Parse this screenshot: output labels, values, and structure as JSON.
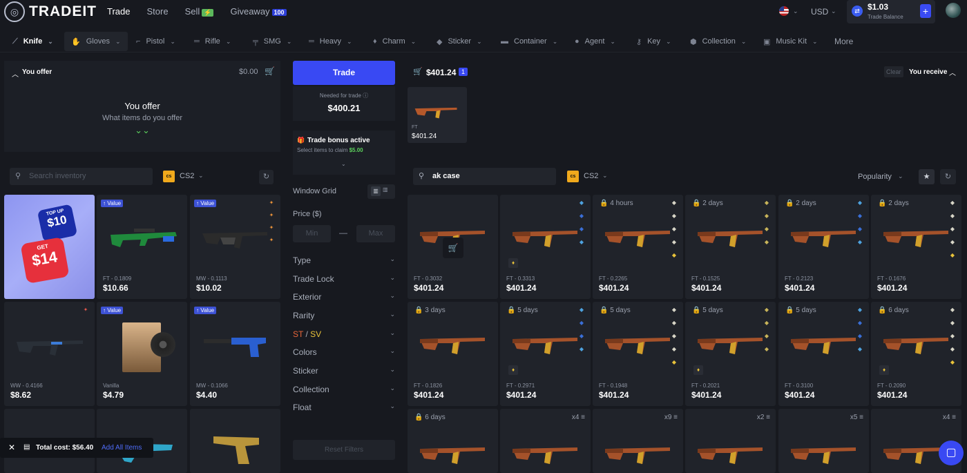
{
  "brand": "TRADEIT",
  "topnav": {
    "trade": "Trade",
    "store": "Store",
    "sell": "Sell",
    "sell_badge": "⚡",
    "giveaway": "Giveaway",
    "giveaway_badge": "100"
  },
  "currency": "USD",
  "balance": {
    "amount": "$1.03",
    "label": "Trade Balance"
  },
  "categories": [
    "Knife",
    "Gloves",
    "Pistol",
    "Rifle",
    "SMG",
    "Heavy",
    "Charm",
    "Sticker",
    "Container",
    "Agent",
    "Key",
    "Collection",
    "Music Kit",
    "More"
  ],
  "offer": {
    "header": "You offer",
    "total": "$0.00",
    "title": "You offer",
    "subtitle": "What items do you offer"
  },
  "search_inv": {
    "placeholder": "Search inventory",
    "game": "CS2"
  },
  "trade": {
    "button": "Trade",
    "needed_label": "Needed for trade",
    "needed_value": "$400.21",
    "bonus_title": "Trade bonus active",
    "bonus_text": "Select items to claim",
    "bonus_amount": "$5.00"
  },
  "filters": {
    "window_grid": "Window Grid",
    "price": "Price ($)",
    "min": "Min",
    "dash": "—",
    "max": "Max",
    "items": [
      "Type",
      "Trade Lock",
      "Exterior",
      "Rarity",
      "ST / SV",
      "Colors",
      "Sticker",
      "Collection",
      "Float"
    ],
    "st": "ST",
    "slash": " / ",
    "sv": "SV",
    "reset": "Reset Filters"
  },
  "receive": {
    "cart_total": "$401.24",
    "cart_count": "1",
    "clear": "Clear",
    "header": "You receive",
    "selected_wear": "FT",
    "selected_price": "$401.24"
  },
  "search_store": {
    "value": "ak case",
    "game": "CS2",
    "sort": "Popularity"
  },
  "promo": {
    "top": "TOP UP",
    "top_amount": "$10",
    "get": "GET",
    "get_amount": "$14"
  },
  "inventory": [
    {
      "tag": "Value",
      "wear": "FT - 0.1809",
      "price": "$10.66",
      "kind": "green"
    },
    {
      "tag": "Value",
      "wear": "MW - 0.1113",
      "price": "$10.02",
      "kind": "ak"
    },
    {
      "tag": "",
      "wear": "WW - 0.4166",
      "price": "$8.62",
      "kind": "m4"
    },
    {
      "tag": "Value",
      "wear": "Vanilla",
      "price": "$4.79",
      "kind": "music"
    },
    {
      "tag": "Value",
      "wear": "MW - 0.1066",
      "price": "$4.40",
      "kind": "pistol"
    }
  ],
  "total_cost": {
    "label": "Total cost: $56.40",
    "add_all": "Add All Items"
  },
  "store_rows": [
    [
      {
        "lock": "",
        "wear": "FT - 0.3032",
        "price": "$401.24"
      },
      {
        "lock": "",
        "wear": "FT - 0.3313",
        "price": "$401.24"
      },
      {
        "lock": "4 hours",
        "wear": "FT - 0.2265",
        "price": "$401.24"
      },
      {
        "lock": "2 days",
        "wear": "FT - 0.1525",
        "price": "$401.24"
      },
      {
        "lock": "2 days",
        "wear": "FT - 0.2123",
        "price": "$401.24"
      },
      {
        "lock": "2 days",
        "wear": "FT - 0.1676",
        "price": "$401.24"
      }
    ],
    [
      {
        "lock": "3 days",
        "wear": "FT - 0.1826",
        "price": "$401.24"
      },
      {
        "lock": "5 days",
        "wear": "FT - 0.2971",
        "price": "$401.24"
      },
      {
        "lock": "5 days",
        "wear": "FT - 0.1948",
        "price": "$401.24"
      },
      {
        "lock": "5 days",
        "wear": "FT - 0.2021",
        "price": "$401.24"
      },
      {
        "lock": "5 days",
        "wear": "FT - 0.3100",
        "price": "$401.24"
      },
      {
        "lock": "6 days",
        "wear": "FT - 0.2090",
        "price": "$401.24"
      }
    ],
    [
      {
        "lock": "6 days",
        "stack": ""
      },
      {
        "lock": "",
        "stack": "x4"
      },
      {
        "lock": "",
        "stack": "x9"
      },
      {
        "lock": "",
        "stack": "x2"
      },
      {
        "lock": "",
        "stack": "x5"
      },
      {
        "lock": "",
        "stack": "x4"
      }
    ]
  ]
}
